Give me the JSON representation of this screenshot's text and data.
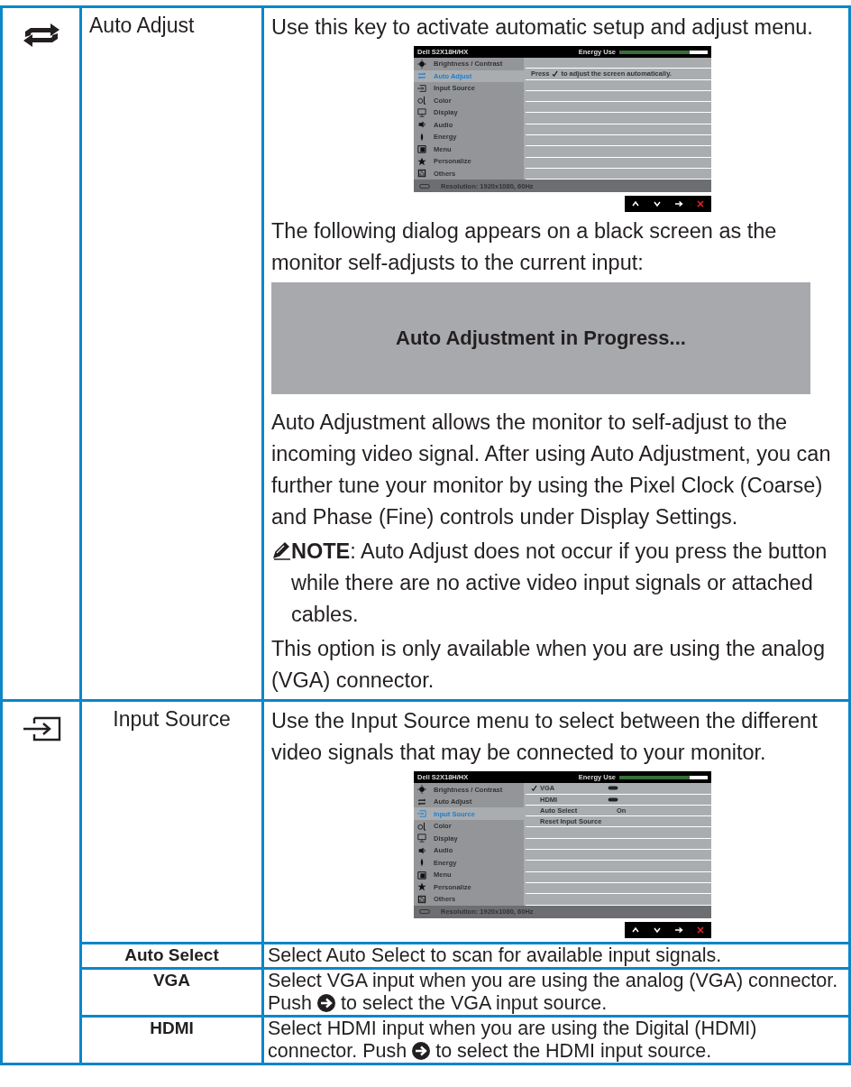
{
  "rows": [
    {
      "title": "Auto Adjust",
      "blocks": [
        {
          "kind": "paragraph",
          "text": "Use this key to activate automatic setup and adjust menu."
        },
        {
          "kind": "osd",
          "title": "Dell S2X18H/HX",
          "energy_label": "Energy Use",
          "energy": {
            "level": 0.8
          },
          "menu": [
            {
              "label": "Brightness / Contrast",
              "selected": false
            },
            {
              "label": "Auto Adjust",
              "selected": true
            },
            {
              "label": "Input Source",
              "selected": false
            },
            {
              "label": "Color",
              "selected": false
            },
            {
              "label": "Display",
              "selected": false
            },
            {
              "label": "Audio",
              "selected": false
            },
            {
              "label": "Energy",
              "selected": false
            },
            {
              "label": "Menu",
              "selected": false
            },
            {
              "label": "Personalize",
              "selected": false
            },
            {
              "label": "Others",
              "selected": false
            }
          ],
          "panel": [
            {
              "kind": "blank"
            },
            {
              "kind": "press",
              "before": "Press",
              "after": "to adjust the screen automatically."
            }
          ],
          "status": "Resolution: 1920x1080, 60Hz"
        },
        {
          "kind": "paragraph",
          "text": "The following dialog appears on a black screen as the monitor self-adjusts to the current input:"
        },
        {
          "kind": "dialog",
          "text": "Auto Adjustment in Progress..."
        },
        {
          "kind": "paragraph",
          "text": "Auto Adjustment allows the monitor to self-adjust to the incoming video signal. After using Auto Adjustment, you can further tune your monitor by using the Pixel Clock (Coarse) and Phase (Fine) controls under Display Settings."
        },
        {
          "kind": "note",
          "text": "**NOTE**: Auto Adjust does not occur if you press the button while there are no active video input signals or attached cables."
        },
        {
          "kind": "paragraph",
          "text": "This option is only available when you are using the analog (VGA) connector."
        }
      ],
      "subrows": []
    },
    {
      "title": "Input Source",
      "blocks": [
        {
          "kind": "paragraph",
          "text": "Use the Input Source menu to select between the different video signals that may be connected to your monitor."
        },
        {
          "kind": "osd",
          "title": "Dell S2X18H/HX",
          "energy_label": "Energy Use",
          "energy": {
            "level": 0.8
          },
          "menu": [
            {
              "label": "Brightness / Contrast",
              "selected": false
            },
            {
              "label": "Auto Adjust",
              "selected": false
            },
            {
              "label": "Input Source",
              "selected": true
            },
            {
              "label": "Color",
              "selected": false
            },
            {
              "label": "Display",
              "selected": false
            },
            {
              "label": "Audio",
              "selected": false
            },
            {
              "label": "Energy",
              "selected": false
            },
            {
              "label": "Menu",
              "selected": false
            },
            {
              "label": "Personalize",
              "selected": false
            },
            {
              "label": "Others",
              "selected": false
            }
          ],
          "panel": [
            {
              "kind": "source",
              "label": "VGA",
              "checked": true
            },
            {
              "kind": "source",
              "label": "HDMI",
              "checked": false
            },
            {
              "kind": "option",
              "label": "Auto Select",
              "value": "On"
            },
            {
              "kind": "option",
              "label": "Reset Input Source"
            }
          ],
          "status": "Resolution: 1920x1080, 60Hz"
        }
      ],
      "subrows": [
        {
          "label": "Auto Select",
          "before": "Select Auto Select to scan for available input signals."
        },
        {
          "label": "VGA",
          "before": "Select VGA input when you are using the analog (VGA) connector. Push",
          "after": "to select the VGA input source."
        },
        {
          "label": "HDMI",
          "before": "Select HDMI input when you are using the Digital (HDMI) connector. Push",
          "after": "to select the HDMI input source."
        }
      ]
    }
  ]
}
